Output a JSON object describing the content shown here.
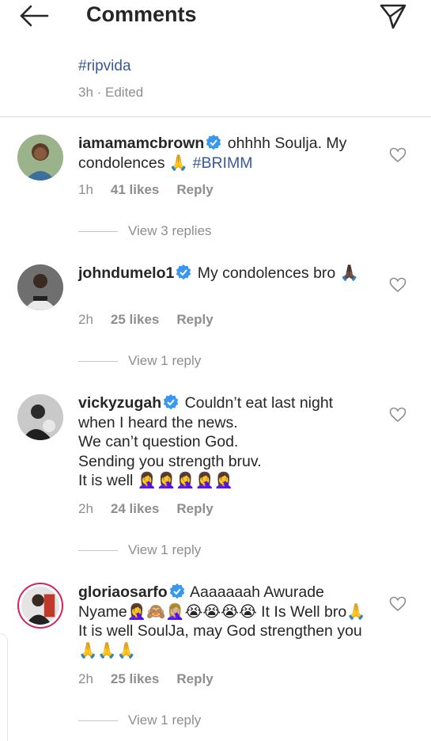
{
  "header": {
    "title": "Comments",
    "back_icon": "arrow-left-icon",
    "send_icon": "paper-plane-icon"
  },
  "caption": {
    "hashtag": "#ripvida",
    "meta": "3h · Edited"
  },
  "comments": [
    {
      "username": "iamamamcbrown",
      "verified": true,
      "text": "ohhhh Soulja. My condolences 🙏",
      "tag": "#BRIMM",
      "time": "1h",
      "likes": "41 likes",
      "reply_label": "Reply",
      "view_replies": "View 3 replies"
    },
    {
      "username": "johndumelo1",
      "verified": true,
      "text": "My condolences bro 🙏🏿",
      "time": "2h",
      "likes": "25 likes",
      "reply_label": "Reply",
      "view_replies": "View 1 reply"
    },
    {
      "username": "vickyzugah",
      "verified": true,
      "text_lines": [
        "Couldn’t eat last night",
        "when I heard the news.",
        "We can’t question God.",
        "Sending you strength bruv.",
        "It is well 🤦‍♀️🤦‍♀️🤦‍♀️🤦‍♀️🤦‍♀️"
      ],
      "time": "2h",
      "likes": "24 likes",
      "reply_label": "Reply",
      "view_replies": "View 1 reply"
    },
    {
      "username": "gloriaosarfo",
      "verified": true,
      "text": "Aaaaaaah Awurade Nyame🤦‍♀️🙈🤦🏼‍♀️😭😭😭😭 It Is Well bro🙏 It is well SoulJa, may God strengthen you🙏🙏🙏",
      "time": "2h",
      "likes": "25 likes",
      "reply_label": "Reply",
      "view_replies": "View 1 reply"
    }
  ],
  "icons": {
    "verified": "verified-badge-icon",
    "like": "heart-outline-icon"
  },
  "colors": {
    "link": "#385898",
    "verified": "#3897f0",
    "muted": "#8e8e8e",
    "story_ring": "#d6245b"
  }
}
